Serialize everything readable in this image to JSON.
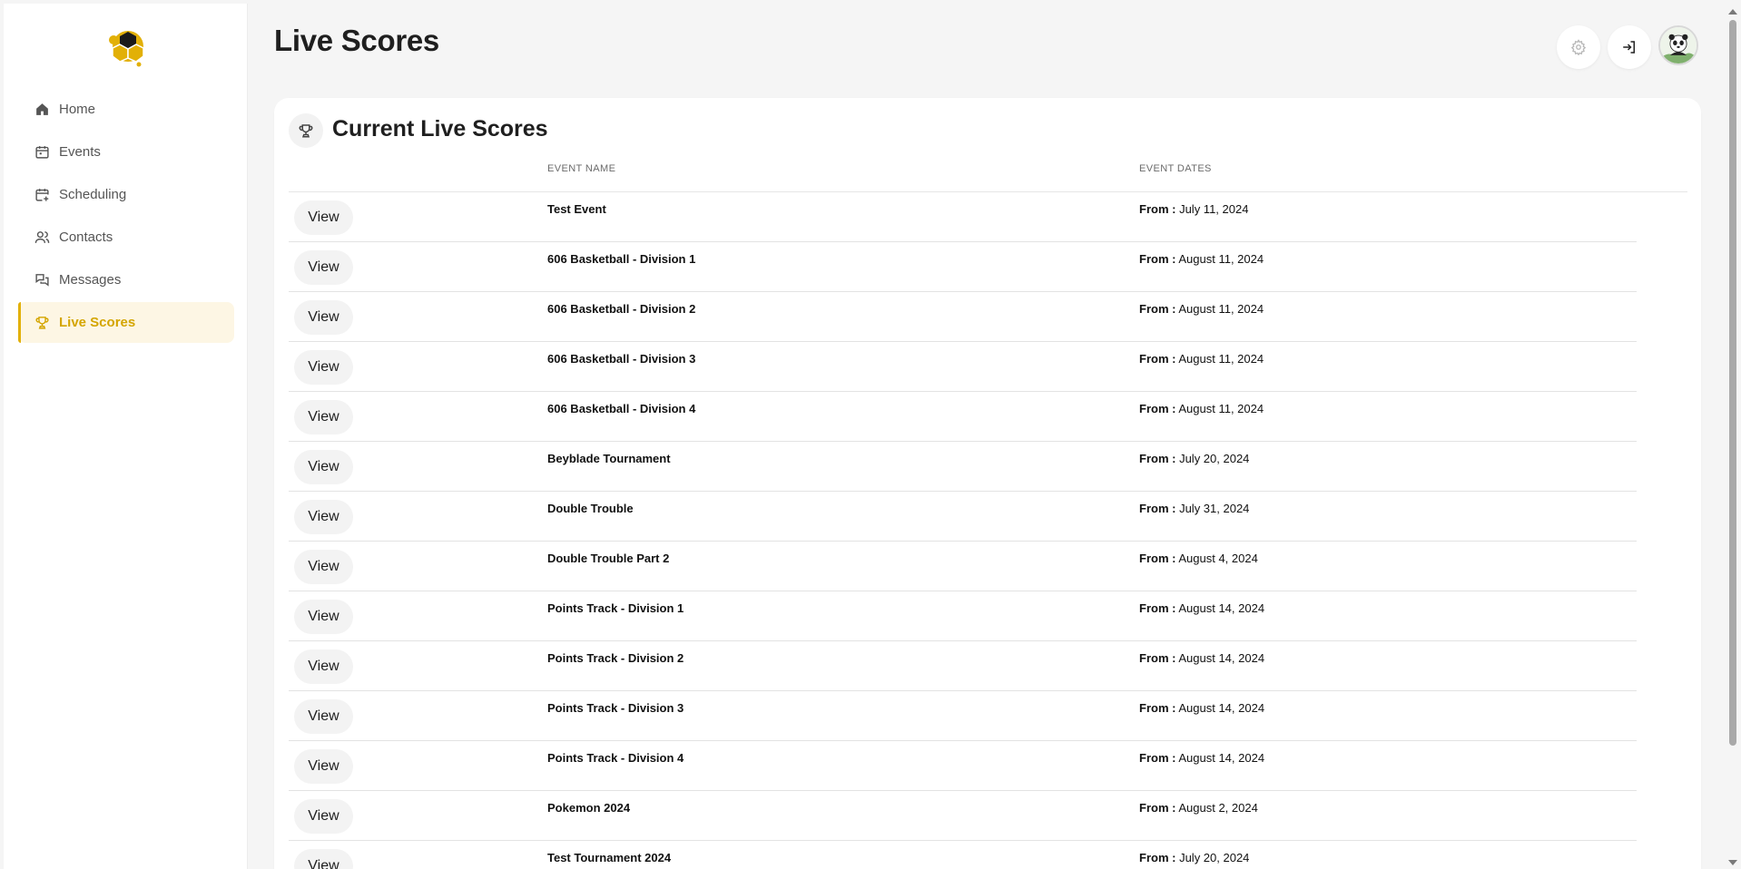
{
  "page_title": "Live Scores",
  "sidebar": {
    "items": [
      {
        "label": "Home",
        "icon": "home-icon",
        "active": false
      },
      {
        "label": "Events",
        "icon": "calendar-icon",
        "active": false
      },
      {
        "label": "Scheduling",
        "icon": "calendar-plus-icon",
        "active": false
      },
      {
        "label": "Contacts",
        "icon": "users-icon",
        "active": false
      },
      {
        "label": "Messages",
        "icon": "messages-icon",
        "active": false
      },
      {
        "label": "Live Scores",
        "icon": "trophy-icon",
        "active": true
      }
    ]
  },
  "header": {
    "buttons": [
      "gear-icon",
      "sign-in-icon"
    ],
    "avatar": "user-avatar"
  },
  "card": {
    "title": "Current Live Scores",
    "icon": "trophy-icon",
    "columns": {
      "name": "EVENT NAME",
      "dates": "EVENT DATES"
    },
    "view_label": "View",
    "from_label": "From :",
    "rows": [
      {
        "name": "Test Event",
        "date": "July 11, 2024"
      },
      {
        "name": "606 Basketball - Division 1",
        "date": "August 11, 2024"
      },
      {
        "name": "606 Basketball - Division 2",
        "date": "August 11, 2024"
      },
      {
        "name": "606 Basketball - Division 3",
        "date": "August 11, 2024"
      },
      {
        "name": "606 Basketball - Division 4",
        "date": "August 11, 2024"
      },
      {
        "name": "Beyblade Tournament",
        "date": "July 20, 2024"
      },
      {
        "name": "Double Trouble",
        "date": "July 31, 2024"
      },
      {
        "name": "Double Trouble Part 2",
        "date": "August 4, 2024"
      },
      {
        "name": "Points Track - Division 1",
        "date": "August 14, 2024"
      },
      {
        "name": "Points Track - Division 2",
        "date": "August 14, 2024"
      },
      {
        "name": "Points Track - Division 3",
        "date": "August 14, 2024"
      },
      {
        "name": "Points Track - Division 4",
        "date": "August 14, 2024"
      },
      {
        "name": "Pokemon 2024",
        "date": "August 2, 2024"
      },
      {
        "name": "Test Tournament 2024",
        "date": "July 20, 2024"
      }
    ]
  },
  "colors": {
    "accent": "#e2b007",
    "accent_bg": "#fdf6e4",
    "page_bg": "#f5f5f5"
  }
}
